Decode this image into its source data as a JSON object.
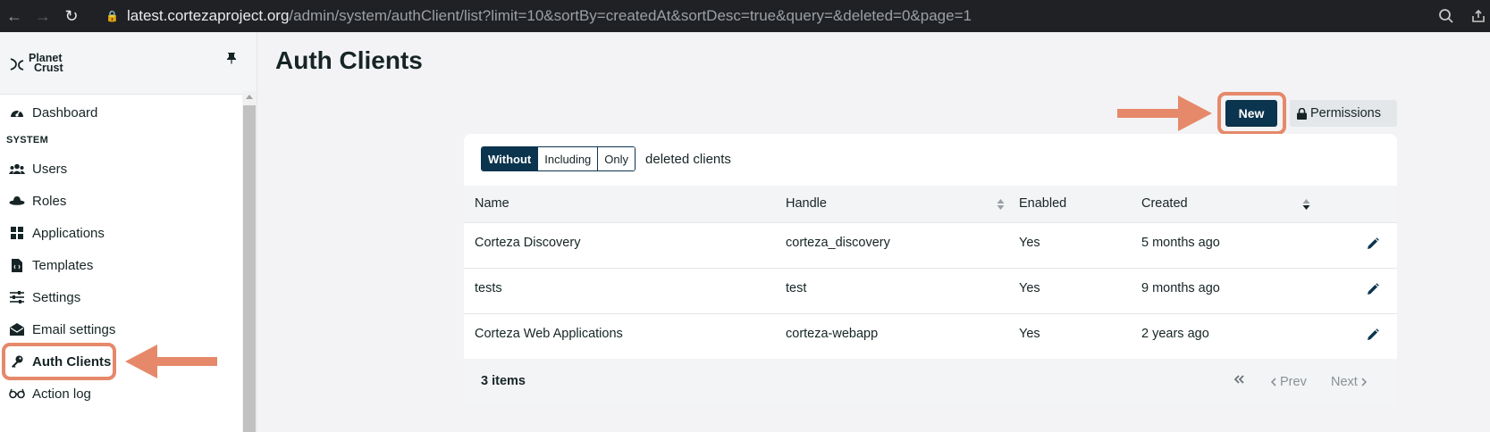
{
  "browser": {
    "url_host": "latest.cortezaproject.org",
    "url_path": "/admin/system/authClient/list?limit=10&sortBy=createdAt&sortDesc=true&query=&deleted=0&page=1"
  },
  "sidebar": {
    "logo_line1": "Planet",
    "logo_line2": "Crust",
    "section_system": "SYSTEM",
    "items": [
      {
        "label": "Dashboard",
        "icon": "dashboard-icon"
      },
      {
        "label": "Users",
        "icon": "users-icon"
      },
      {
        "label": "Roles",
        "icon": "roles-icon"
      },
      {
        "label": "Applications",
        "icon": "applications-icon"
      },
      {
        "label": "Templates",
        "icon": "templates-icon"
      },
      {
        "label": "Settings",
        "icon": "settings-icon"
      },
      {
        "label": "Email settings",
        "icon": "email-icon"
      },
      {
        "label": "Auth Clients",
        "icon": "key-icon",
        "active": true
      },
      {
        "label": "Action log",
        "icon": "glasses-icon"
      }
    ]
  },
  "main": {
    "title": "Auth Clients",
    "new_button": "New",
    "permissions_button": "Permissions",
    "filter": {
      "options": [
        "Without",
        "Including",
        "Only"
      ],
      "selected": "Without",
      "suffix": "deleted clients"
    },
    "table": {
      "columns": [
        "Name",
        "Handle",
        "Enabled",
        "Created"
      ],
      "rows": [
        {
          "name": "Corteza Discovery",
          "handle": "corteza_discovery",
          "enabled": "Yes",
          "created": "5 months ago"
        },
        {
          "name": "tests",
          "handle": "test",
          "enabled": "Yes",
          "created": "9 months ago"
        },
        {
          "name": "Corteza Web Applications",
          "handle": "corteza-webapp",
          "enabled": "Yes",
          "created": "2 years ago"
        }
      ]
    },
    "footer": {
      "count": "3 items",
      "prev": "Prev",
      "next": "Next"
    }
  },
  "colors": {
    "accent": "#0b344e",
    "annotation": "#e5896a"
  }
}
